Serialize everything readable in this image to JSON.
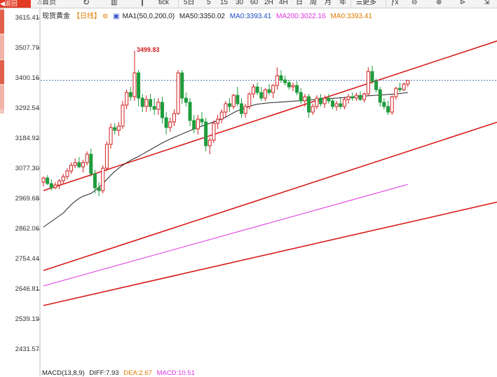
{
  "toolbar": {
    "back": "返回",
    "home": "首页",
    "tick": "tick",
    "periods": [
      "5日",
      "5",
      "15",
      "30",
      "60",
      "2H",
      "4H",
      "日",
      "周",
      "月",
      "年"
    ],
    "more": "更多"
  },
  "legend": {
    "instrument": "现货黄金",
    "period": "【日线】",
    "ma1": "MA1(50,0,200,0)",
    "ma50": "MA50:3350.02",
    "ma0a": "MA0:3393.41",
    "ma200": "MA200:3022.16",
    "ma0b": "MA0:3393.41"
  },
  "macd": {
    "label": "MACD(13,8,9)",
    "diff": "DIFF:7.93",
    "dea": "DEA:2.67",
    "macd": "MACD:10.51"
  },
  "colors": {
    "up": "#d11f1f",
    "down": "#1f9c3d",
    "ma50": "#222222",
    "ma200": "#e033e0",
    "channel": "#d81b1b",
    "back_button": "#e23a24"
  },
  "chart_data": {
    "type": "candlestick",
    "y_ticks": [
      3615.41,
      3507.79,
      3400.16,
      3292.54,
      3184.92,
      3077.3,
      2969.68,
      2862.06,
      2754.44,
      2646.81,
      2539.19,
      2431.57
    ],
    "ylim": [
      2380,
      3650
    ],
    "current_price": 3393.41,
    "high_annotation": "3499.83",
    "high_value": 3499.83,
    "ohlc": [
      [
        3030,
        3050,
        3015,
        3045
      ],
      [
        3045,
        3055,
        3020,
        3025
      ],
      [
        3025,
        3040,
        3000,
        3010
      ],
      [
        3010,
        3030,
        3005,
        3020
      ],
      [
        3020,
        3040,
        3005,
        3035
      ],
      [
        3035,
        3060,
        3025,
        3050
      ],
      [
        3050,
        3080,
        3040,
        3070
      ],
      [
        3070,
        3100,
        3060,
        3090
      ],
      [
        3090,
        3115,
        3080,
        3100
      ],
      [
        3100,
        3120,
        3080,
        3085
      ],
      [
        3085,
        3110,
        3065,
        3100
      ],
      [
        3100,
        3140,
        3090,
        3130
      ],
      [
        3130,
        3150,
        3050,
        3060
      ],
      [
        3060,
        3075,
        2990,
        3010
      ],
      [
        3010,
        3030,
        2980,
        3000
      ],
      [
        3000,
        3090,
        2990,
        3080
      ],
      [
        3080,
        3175,
        3070,
        3165
      ],
      [
        3165,
        3240,
        3150,
        3225
      ],
      [
        3225,
        3240,
        3200,
        3215
      ],
      [
        3215,
        3245,
        3195,
        3230
      ],
      [
        3230,
        3320,
        3220,
        3305
      ],
      [
        3305,
        3360,
        3290,
        3350
      ],
      [
        3350,
        3370,
        3320,
        3335
      ],
      [
        3335,
        3499.83,
        3320,
        3420
      ],
      [
        3420,
        3430,
        3300,
        3330
      ],
      [
        3330,
        3345,
        3280,
        3300
      ],
      [
        3300,
        3340,
        3280,
        3325
      ],
      [
        3325,
        3345,
        3285,
        3300
      ],
      [
        3300,
        3330,
        3270,
        3290
      ],
      [
        3290,
        3330,
        3270,
        3315
      ],
      [
        3315,
        3335,
        3240,
        3260
      ],
      [
        3260,
        3280,
        3200,
        3225
      ],
      [
        3225,
        3260,
        3210,
        3245
      ],
      [
        3245,
        3290,
        3230,
        3275
      ],
      [
        3275,
        3430,
        3270,
        3420
      ],
      [
        3420,
        3430,
        3310,
        3330
      ],
      [
        3330,
        3350,
        3300,
        3315
      ],
      [
        3315,
        3330,
        3230,
        3250
      ],
      [
        3250,
        3270,
        3205,
        3220
      ],
      [
        3220,
        3270,
        3200,
        3255
      ],
      [
        3255,
        3280,
        3230,
        3245
      ],
      [
        3245,
        3260,
        3140,
        3160
      ],
      [
        3160,
        3190,
        3130,
        3180
      ],
      [
        3180,
        3250,
        3170,
        3240
      ],
      [
        3240,
        3270,
        3220,
        3255
      ],
      [
        3255,
        3290,
        3240,
        3280
      ],
      [
        3280,
        3320,
        3260,
        3310
      ],
      [
        3310,
        3330,
        3280,
        3300
      ],
      [
        3300,
        3345,
        3290,
        3340
      ],
      [
        3340,
        3370,
        3300,
        3310
      ],
      [
        3310,
        3330,
        3260,
        3275
      ],
      [
        3275,
        3310,
        3260,
        3300
      ],
      [
        3300,
        3350,
        3290,
        3345
      ],
      [
        3345,
        3380,
        3330,
        3370
      ],
      [
        3370,
        3385,
        3340,
        3350
      ],
      [
        3350,
        3370,
        3320,
        3330
      ],
      [
        3330,
        3365,
        3320,
        3360
      ],
      [
        3360,
        3380,
        3340,
        3350
      ],
      [
        3350,
        3380,
        3330,
        3375
      ],
      [
        3375,
        3440,
        3360,
        3410
      ],
      [
        3410,
        3430,
        3385,
        3395
      ],
      [
        3395,
        3410,
        3375,
        3385
      ],
      [
        3385,
        3395,
        3360,
        3370
      ],
      [
        3370,
        3385,
        3355,
        3375
      ],
      [
        3375,
        3390,
        3340,
        3350
      ],
      [
        3350,
        3365,
        3310,
        3320
      ],
      [
        3320,
        3345,
        3300,
        3335
      ],
      [
        3335,
        3345,
        3260,
        3280
      ],
      [
        3280,
        3310,
        3270,
        3300
      ],
      [
        3300,
        3340,
        3290,
        3330
      ],
      [
        3330,
        3345,
        3300,
        3310
      ],
      [
        3310,
        3340,
        3295,
        3330
      ],
      [
        3330,
        3345,
        3310,
        3320
      ],
      [
        3320,
        3330,
        3290,
        3300
      ],
      [
        3300,
        3320,
        3285,
        3310
      ],
      [
        3310,
        3330,
        3290,
        3300
      ],
      [
        3300,
        3335,
        3290,
        3325
      ],
      [
        3325,
        3345,
        3310,
        3335
      ],
      [
        3335,
        3350,
        3320,
        3330
      ],
      [
        3330,
        3350,
        3320,
        3340
      ],
      [
        3340,
        3355,
        3320,
        3325
      ],
      [
        3325,
        3350,
        3315,
        3345
      ],
      [
        3345,
        3440,
        3340,
        3425
      ],
      [
        3425,
        3445,
        3380,
        3390
      ],
      [
        3390,
        3400,
        3350,
        3360
      ],
      [
        3360,
        3370,
        3300,
        3315
      ],
      [
        3315,
        3330,
        3290,
        3300
      ],
      [
        3300,
        3320,
        3270,
        3280
      ],
      [
        3280,
        3340,
        3270,
        3335
      ],
      [
        3335,
        3370,
        3325,
        3365
      ],
      [
        3365,
        3385,
        3350,
        3360
      ],
      [
        3360,
        3385,
        3355,
        3380
      ],
      [
        3380,
        3395,
        3370,
        3393.41
      ]
    ],
    "ma50": [
      2870,
      2880,
      2890,
      2900,
      2910,
      2920,
      2935,
      2950,
      2962,
      2972,
      2980,
      2985,
      2990,
      3000,
      3012,
      3025,
      3040,
      3055,
      3068,
      3080,
      3090,
      3100,
      3108,
      3115,
      3122,
      3130,
      3138,
      3146,
      3154,
      3162,
      3170,
      3177,
      3184,
      3190,
      3196,
      3202,
      3208,
      3214,
      3220,
      3225,
      3230,
      3235,
      3240,
      3245,
      3250,
      3255,
      3262,
      3270,
      3278,
      3285,
      3290,
      3295,
      3300,
      3305,
      3308,
      3310,
      3312,
      3313,
      3314,
      3315,
      3316,
      3317,
      3318,
      3319,
      3320,
      3321,
      3322,
      3323,
      3324,
      3325,
      3326,
      3327,
      3328,
      3329,
      3330,
      3331,
      3332,
      3333,
      3334,
      3335,
      3336,
      3337,
      3338,
      3339,
      3340,
      3341,
      3342,
      3343,
      3344,
      3345,
      3346,
      3348,
      3350.02
    ],
    "ma200": [
      2660,
      3022.16
    ],
    "channel_lines": [
      {
        "from": [
          0,
          3000
        ],
        "to": [
          118,
          3550
        ]
      },
      {
        "from": [
          0,
          2715
        ],
        "to": [
          118,
          3260
        ]
      },
      {
        "from": [
          0,
          2590
        ],
        "to": [
          118,
          2970
        ]
      }
    ]
  }
}
